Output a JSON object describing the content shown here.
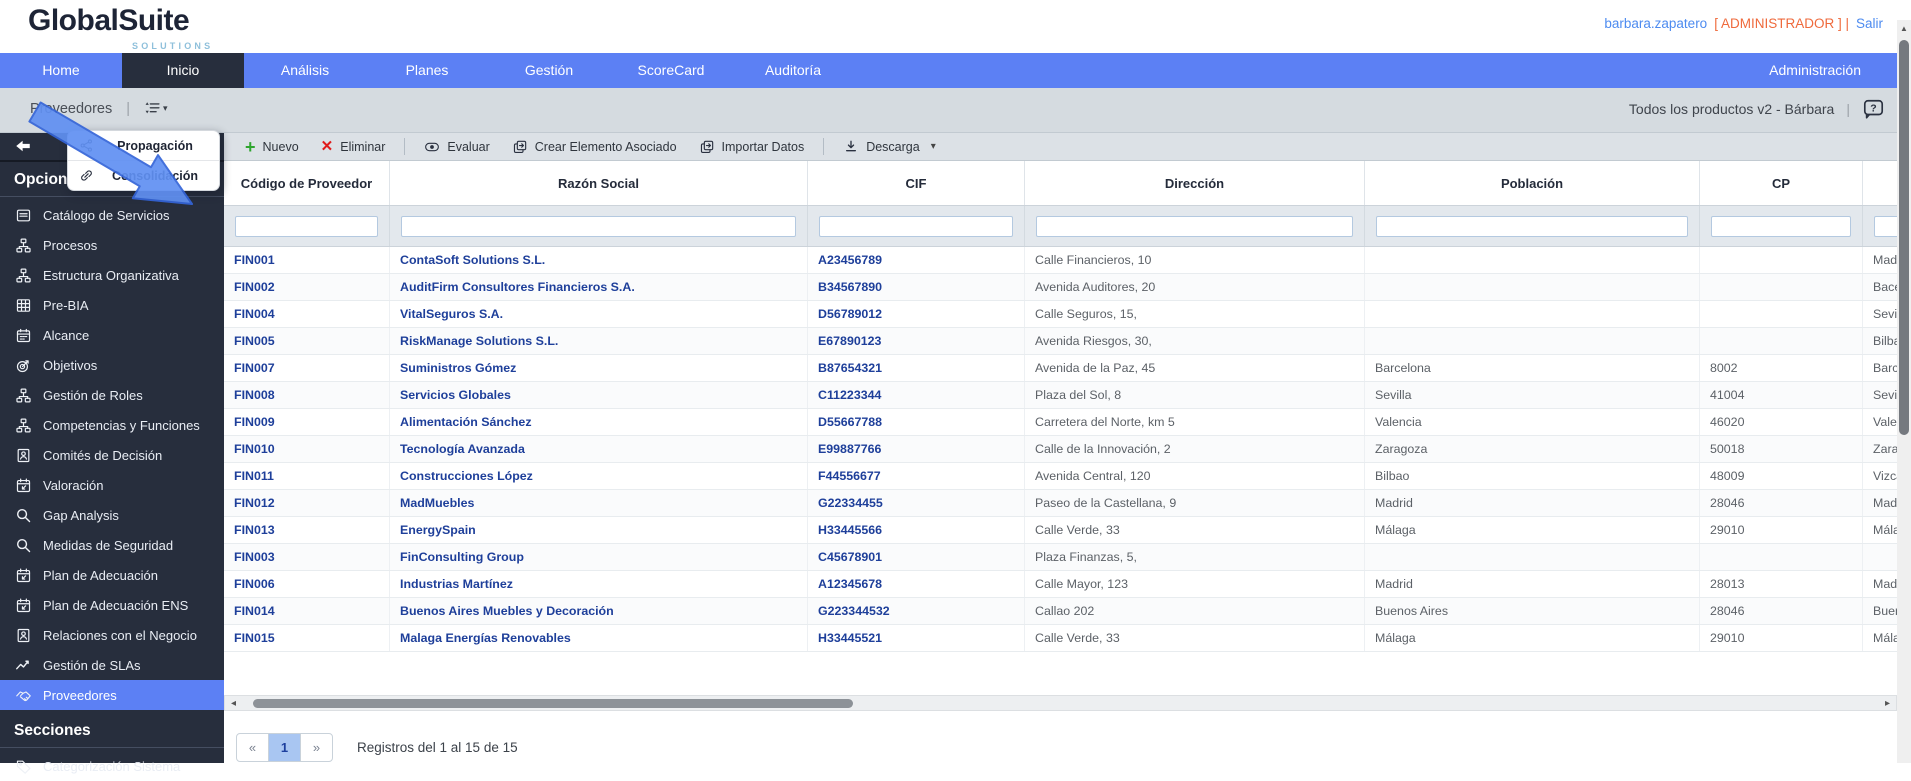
{
  "header": {
    "logo_text": "GlobalSuite",
    "logo_subtext": "SOLUTIONS",
    "user": "barbara.zapatero",
    "role_bracketed": "[ ADMINISTRADOR ] |",
    "logout": "Salir"
  },
  "nav": {
    "items": [
      "Home",
      "Inicio",
      "Análisis",
      "Planes",
      "Gestión",
      "ScoreCard",
      "Auditoría"
    ],
    "active_index": 1,
    "right_item": "Administración"
  },
  "breadcrumb": {
    "title": "Proveedores",
    "separator": "|",
    "context": "Todos los productos v2 - Bárbara"
  },
  "context_menu": {
    "items": [
      {
        "label": "Propagación",
        "icon": "share"
      },
      {
        "label": "Consolidación",
        "icon": "link"
      }
    ]
  },
  "sidebar": {
    "heading_options": "Opciones",
    "heading_sections": "Secciones",
    "items": [
      {
        "label": "Catálogo de Servicios",
        "icon": "doc"
      },
      {
        "label": "Procesos",
        "icon": "tree"
      },
      {
        "label": "Estructura Organizativa",
        "icon": "tree"
      },
      {
        "label": "Pre-BIA",
        "icon": "grid"
      },
      {
        "label": "Alcance",
        "icon": "cal"
      },
      {
        "label": "Objetivos",
        "icon": "target"
      },
      {
        "label": "Gestión de Roles",
        "icon": "tree"
      },
      {
        "label": "Competencias y Funciones",
        "icon": "tree"
      },
      {
        "label": "Comités de Decisión",
        "icon": "person-card"
      },
      {
        "label": "Valoración",
        "icon": "cal-arrow"
      },
      {
        "label": "Gap Analysis",
        "icon": "search"
      },
      {
        "label": "Medidas de Seguridad",
        "icon": "search"
      },
      {
        "label": "Plan de Adecuación",
        "icon": "cal-arrow"
      },
      {
        "label": "Plan de Adecuación ENS",
        "icon": "cal-arrow"
      },
      {
        "label": "Relaciones con el Negocio",
        "icon": "person-card"
      },
      {
        "label": "Gestión de SLAs",
        "icon": "chart"
      },
      {
        "label": "Proveedores",
        "icon": "handshake",
        "active": true
      }
    ],
    "section_items": [
      {
        "label": "Categorización Sistema",
        "icon": "tag"
      }
    ]
  },
  "toolbar": {
    "buttons": [
      {
        "label": "Nuevo",
        "icon": "plus"
      },
      {
        "label": "Eliminar",
        "icon": "x"
      },
      {
        "label": "Evaluar",
        "icon": "eye"
      },
      {
        "label": "Crear Elemento Asociado",
        "icon": "copy"
      },
      {
        "label": "Importar Datos",
        "icon": "copy"
      },
      {
        "label": "Descarga",
        "icon": "download",
        "caret": true
      }
    ]
  },
  "table": {
    "columns": [
      "Código de Proveedor",
      "Razón Social",
      "CIF",
      "Dirección",
      "Población",
      "CP",
      ""
    ],
    "rows": [
      [
        "FIN001",
        "ContaSoft Solutions S.L.",
        "A23456789",
        "Calle Financieros, 10",
        "",
        "",
        "Madr"
      ],
      [
        "FIN002",
        "AuditFirm Consultores Financieros S.A.",
        "B34567890",
        "Avenida Auditores, 20",
        "",
        "",
        "Bace"
      ],
      [
        "FIN004",
        "VitalSeguros S.A.",
        "D56789012",
        "Calle Seguros, 15,",
        "",
        "",
        "Sevil"
      ],
      [
        "FIN005",
        "RiskManage Solutions S.L.",
        "E67890123",
        "Avenida Riesgos, 30,",
        "",
        "",
        "Bilba"
      ],
      [
        "FIN007",
        "Suministros Gómez",
        "B87654321",
        "Avenida de la Paz, 45",
        "Barcelona",
        "8002",
        "Barce"
      ],
      [
        "FIN008",
        "Servicios Globales",
        "C11223344",
        "Plaza del Sol, 8",
        "Sevilla",
        "41004",
        "Sevil"
      ],
      [
        "FIN009",
        "Alimentación Sánchez",
        "D55667788",
        "Carretera del Norte, km 5",
        "Valencia",
        "46020",
        "Valen"
      ],
      [
        "FIN010",
        "Tecnología Avanzada",
        "E99887766",
        "Calle de la Innovación, 2",
        "Zaragoza",
        "50018",
        "Zarag"
      ],
      [
        "FIN011",
        "Construcciones López",
        "F44556677",
        "Avenida Central, 120",
        "Bilbao",
        "48009",
        "Vizca"
      ],
      [
        "FIN012",
        "MadMuebles",
        "G22334455",
        "Paseo de la Castellana, 9",
        "Madrid",
        "28046",
        "Madr"
      ],
      [
        "FIN013",
        "EnergySpain",
        "H33445566",
        "Calle Verde, 33",
        "Málaga",
        "29010",
        "Mála"
      ],
      [
        "FIN003",
        "FinConsulting Group",
        "C45678901",
        "Plaza Finanzas, 5,",
        "",
        "",
        ""
      ],
      [
        "FIN006",
        "Industrias Martínez",
        "A12345678",
        "Calle Mayor, 123",
        "Madrid",
        "28013",
        "Madr"
      ],
      [
        "FIN014",
        "Buenos Aires Muebles y Decoración",
        "G223344532",
        "Callao 202",
        "Buenos Aires",
        "28046",
        "Buen"
      ],
      [
        "FIN015",
        "Malaga Energías Renovables",
        "H33445521",
        "Calle Verde, 33",
        "Málaga",
        "29010",
        "Mála"
      ]
    ]
  },
  "pagination": {
    "first": "«",
    "page": "1",
    "last": "»",
    "summary": "Registros del 1 al 15 de 15"
  },
  "colors": {
    "accent_blue": "#5c80f4",
    "sidebar_navy": "#272e3d",
    "link_blue": "#1e3f9a",
    "success_green": "#2ea52e",
    "danger_red": "#e01b1b",
    "role_orange": "#ef6a3c"
  }
}
